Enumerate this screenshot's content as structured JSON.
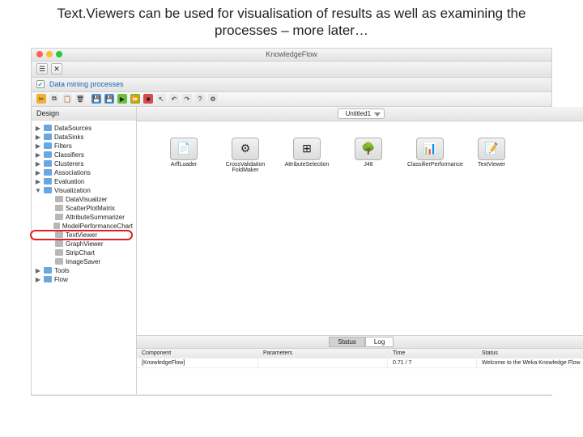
{
  "slide_title": "Text.Viewers can be used for visualisation of results as well as examining the processes – more later…",
  "window_title": "KnowledgeFlow",
  "program_text": "Data mining processes",
  "design_label": "Design",
  "tab_label": "Untitled1",
  "tree": [
    {
      "label": "DataSources",
      "expanded": false
    },
    {
      "label": "DataSinks",
      "expanded": false
    },
    {
      "label": "Filters",
      "expanded": false
    },
    {
      "label": "Classifiers",
      "expanded": false
    },
    {
      "label": "Clusterers",
      "expanded": false
    },
    {
      "label": "Associations",
      "expanded": false
    },
    {
      "label": "Evaluation",
      "expanded": false
    },
    {
      "label": "Visualization",
      "expanded": true,
      "children": [
        {
          "label": "DataVisualizer"
        },
        {
          "label": "ScatterPlotMatrix"
        },
        {
          "label": "AttributeSummarizer"
        },
        {
          "label": "ModelPerformanceChart"
        },
        {
          "label": "TextViewer",
          "highlight": true
        },
        {
          "label": "GraphViewer"
        },
        {
          "label": "StripChart"
        },
        {
          "label": "ImageSaver"
        }
      ]
    },
    {
      "label": "Tools",
      "expanded": false
    },
    {
      "label": "Flow",
      "expanded": false
    }
  ],
  "canvas_nodes": [
    {
      "label": "ArffLoader",
      "glyph": "📄"
    },
    {
      "label": "CrossValidation FoldMaker",
      "glyph": "⚙"
    },
    {
      "label": "AttributeSelection",
      "glyph": "⊞"
    },
    {
      "label": "J48",
      "glyph": "🌳"
    },
    {
      "label": "ClassifierPerformance",
      "glyph": "📊"
    },
    {
      "label": "TextViewer",
      "glyph": "📝"
    }
  ],
  "status_tabs": {
    "tab1": "Status",
    "tab2": "Log"
  },
  "status_table": {
    "headers": [
      "Component",
      "Parameters",
      "Time",
      "Status"
    ],
    "row": [
      "[KnowledgeFlow]",
      "",
      "0.71 / 7",
      "Welcome to the Weka Knowledge Flow"
    ]
  }
}
